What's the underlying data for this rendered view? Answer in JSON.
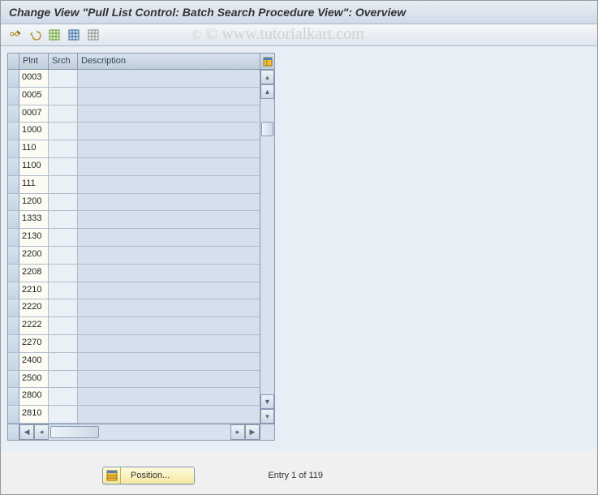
{
  "title": "Change View \"Pull List Control: Batch Search Procedure View\": Overview",
  "watermark": "© www.tutorialkart.com",
  "toolbar": {
    "icons": [
      "change-toggle",
      "pencil",
      "save",
      "select-all",
      "deselect"
    ]
  },
  "grid": {
    "columns": {
      "plnt": "Plnt",
      "srch": "Srch",
      "desc": "Description"
    },
    "rows": [
      {
        "plnt": "0003",
        "srch": "",
        "desc": ""
      },
      {
        "plnt": "0005",
        "srch": "",
        "desc": ""
      },
      {
        "plnt": "0007",
        "srch": "",
        "desc": ""
      },
      {
        "plnt": "1000",
        "srch": "",
        "desc": ""
      },
      {
        "plnt": "110",
        "srch": "",
        "desc": ""
      },
      {
        "plnt": "1100",
        "srch": "",
        "desc": ""
      },
      {
        "plnt": "111",
        "srch": "",
        "desc": ""
      },
      {
        "plnt": "1200",
        "srch": "",
        "desc": ""
      },
      {
        "plnt": "1333",
        "srch": "",
        "desc": ""
      },
      {
        "plnt": "2130",
        "srch": "",
        "desc": ""
      },
      {
        "plnt": "2200",
        "srch": "",
        "desc": ""
      },
      {
        "plnt": "2208",
        "srch": "",
        "desc": ""
      },
      {
        "plnt": "2210",
        "srch": "",
        "desc": ""
      },
      {
        "plnt": "2220",
        "srch": "",
        "desc": ""
      },
      {
        "plnt": "2222",
        "srch": "",
        "desc": ""
      },
      {
        "plnt": "2270",
        "srch": "",
        "desc": ""
      },
      {
        "plnt": "2400",
        "srch": "",
        "desc": ""
      },
      {
        "plnt": "2500",
        "srch": "",
        "desc": ""
      },
      {
        "plnt": "2800",
        "srch": "",
        "desc": ""
      },
      {
        "plnt": "2810",
        "srch": "",
        "desc": ""
      }
    ]
  },
  "footer": {
    "position_label": "Position...",
    "entry_status": "Entry 1 of 119"
  }
}
